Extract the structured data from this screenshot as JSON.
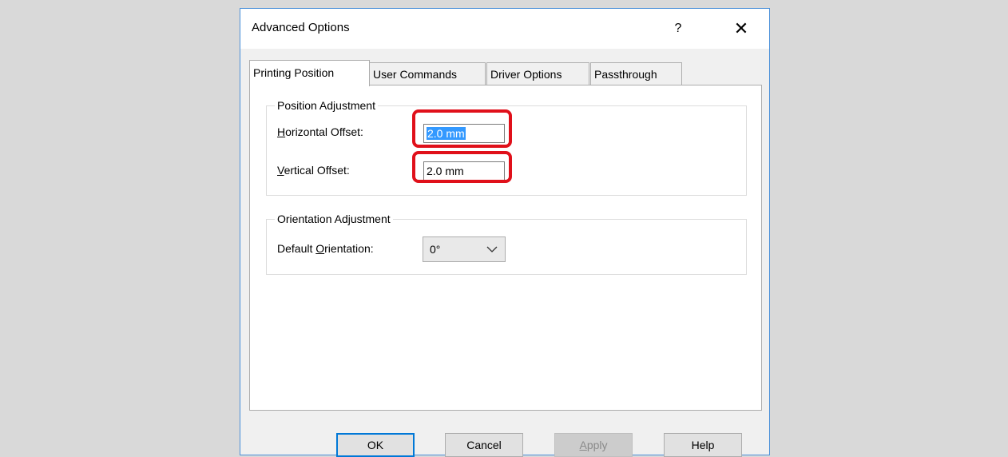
{
  "dialog": {
    "title": "Advanced Options",
    "help_glyph": "?",
    "close_glyph": "✕"
  },
  "tabs": [
    {
      "label": "Printing Position",
      "active": true
    },
    {
      "label": "User Commands",
      "active": false
    },
    {
      "label": "Driver Options",
      "active": false
    },
    {
      "label": "Passthrough",
      "active": false
    }
  ],
  "position_adjustment": {
    "title": "Position Adjustment",
    "horizontal": {
      "label_access": "H",
      "label_rest": "orizontal Offset:",
      "value": "2.0 mm"
    },
    "vertical": {
      "label_access": "V",
      "label_rest": "ertical Offset:",
      "value": "2.0 mm"
    }
  },
  "orientation_adjustment": {
    "title": "Orientation Adjustment",
    "label_pre": "Default ",
    "label_access": "O",
    "label_rest": "rientation:",
    "selected": "0°"
  },
  "buttons": {
    "ok": "OK",
    "cancel": "Cancel",
    "apply_access": "A",
    "apply_rest": "pply",
    "help": "Help"
  },
  "colors": {
    "highlight": "#e0101a",
    "selection": "#3399ff",
    "accent": "#0078d7"
  }
}
